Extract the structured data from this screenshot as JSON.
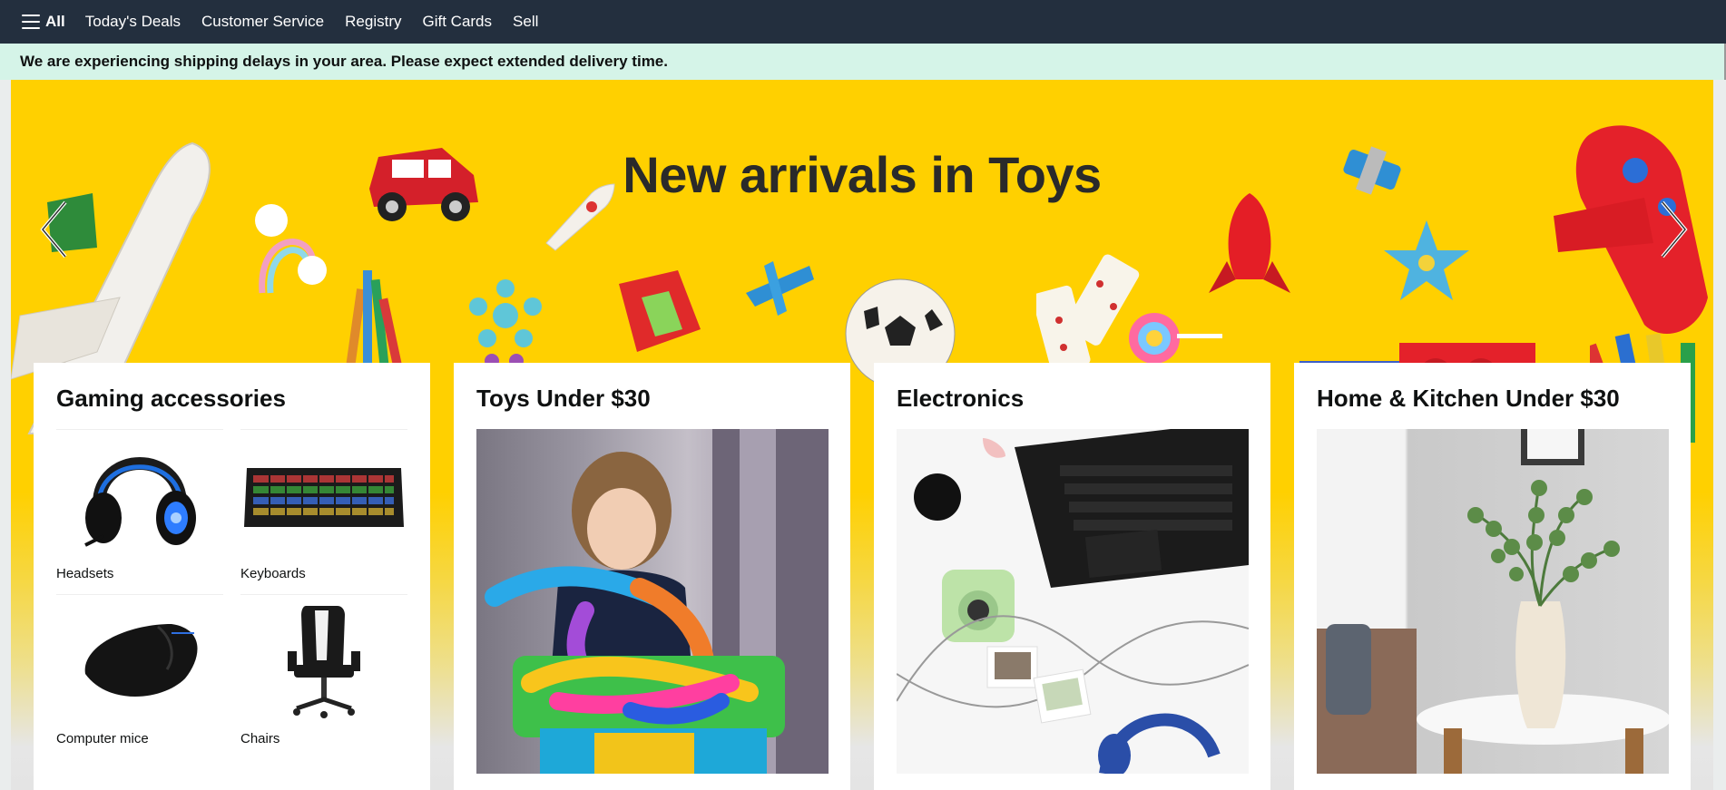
{
  "nav": {
    "all_label": "All",
    "links": [
      "Today's Deals",
      "Customer Service",
      "Registry",
      "Gift Cards",
      "Sell"
    ],
    "background": "#232f3e"
  },
  "alert": {
    "message": "We are experiencing shipping delays in your area. Please expect extended delivery time.",
    "background": "#d5f4e8"
  },
  "hero": {
    "title": "New arrivals in Toys",
    "background": "#ffd000",
    "prev_icon": "chevron-left-icon",
    "next_icon": "chevron-right-icon"
  },
  "cards": [
    {
      "title": "Gaming accessories",
      "items": [
        {
          "label": "Headsets",
          "icon": "headset-image"
        },
        {
          "label": "Keyboards",
          "icon": "keyboard-image"
        },
        {
          "label": "Computer mice",
          "icon": "mouse-image"
        },
        {
          "label": "Chairs",
          "icon": "chair-image"
        }
      ]
    },
    {
      "title": "Toys Under $30",
      "image": "child-playing-with-tubes-image"
    },
    {
      "title": "Electronics",
      "image": "laptop-camera-headphones-image"
    },
    {
      "title": "Home & Kitchen Under $30",
      "image": "plant-vase-table-image"
    }
  ]
}
